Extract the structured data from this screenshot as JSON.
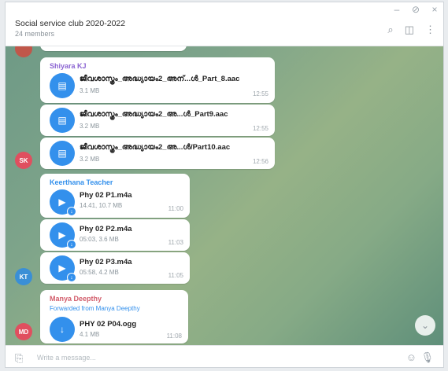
{
  "window_controls": {
    "minimize": "–",
    "pin": "⊘",
    "close": "×"
  },
  "header": {
    "title": "Social service club 2020-2022",
    "subtitle": "24 members",
    "icons": {
      "search": "⌕",
      "sidebar": "◫",
      "menu": "⋮"
    }
  },
  "messages": [
    {
      "sender": "Shiyara KJ",
      "sender_color": "#8a63d2",
      "files": [
        {
          "name": "ജീവശാസ്ത്രം_അദ്ധ്യായം2_അന്...ൾ_Part_8.aac",
          "size": "3.1 MB",
          "time": "12:55"
        },
        {
          "name": "ജീവശാസ്ത്രം_അദ്ധ്യായം2_അ...ൾ_Part9.aac",
          "size": "3.2 MB",
          "time": "12:55"
        },
        {
          "name": "ജീവശാസ്ത്രം_അദ്ധ്യായം2_അ...ൾ/Part10.aac",
          "size": "3.2 MB",
          "time": "12:56"
        }
      ],
      "avatar_initials": "SK",
      "avatar_color": "#e04f5f"
    },
    {
      "sender": "Keerthana Teacher",
      "sender_color": "#3390ec",
      "files": [
        {
          "name": "Phy 02 P1.m4a",
          "size": "14.41, 10.7 MB",
          "time": "11:00"
        },
        {
          "name": "Phy 02 P2.m4a",
          "size": "05:03, 3.6 MB",
          "time": "11:03"
        },
        {
          "name": "Phy 02 P3.m4a",
          "size": "05:58, 4.2 MB",
          "time": "11:05"
        }
      ],
      "avatar_initials": "KT",
      "avatar_color": "#3a8fd6"
    },
    {
      "sender": "Manya Deepthy",
      "sender_color": "#d25d6b",
      "forwarded": "Forwarded from Manya Deepthy",
      "files": [
        {
          "name": "PHY 02 P04.ogg",
          "size": "4.1 MB",
          "time": "11:08"
        }
      ],
      "avatar_initials": "MD",
      "avatar_color": "#e04f5f"
    }
  ],
  "composer": {
    "placeholder": "Write a message...",
    "attach_icon": "⎘",
    "emoji_icon": "☺",
    "mic_icon": "🎙"
  },
  "scroll_icon": "⌄"
}
